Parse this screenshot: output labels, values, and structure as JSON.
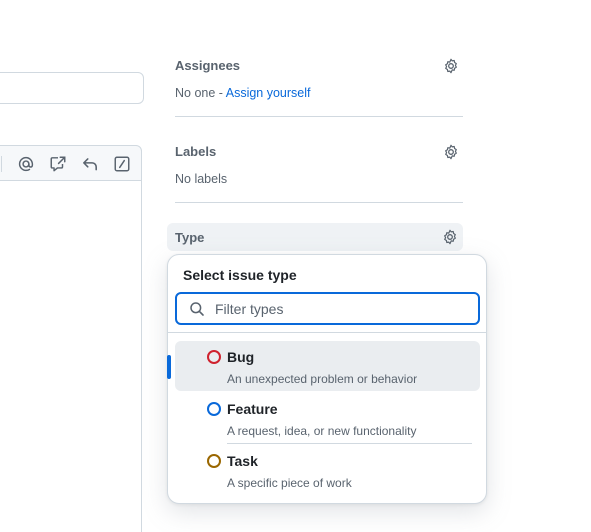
{
  "sidebar": {
    "assignees": {
      "title": "Assignees",
      "value_prefix": "No one - ",
      "assign_link": "Assign yourself"
    },
    "labels": {
      "title": "Labels",
      "value": "No labels"
    },
    "type": {
      "title": "Type"
    }
  },
  "type_dropdown": {
    "title": "Select issue type",
    "filter_placeholder": "Filter types",
    "options": [
      {
        "name": "Bug",
        "description": "An unexpected problem or behavior",
        "color": "#cf222e",
        "selected": true
      },
      {
        "name": "Feature",
        "description": "A request, idea, or new functionality",
        "color": "#0969da",
        "selected": false
      },
      {
        "name": "Task",
        "description": "A specific piece of work",
        "color": "#9a6700",
        "selected": false
      }
    ]
  },
  "editor_toolbar": {
    "icons": [
      "mention-icon",
      "cross-reference-icon",
      "reply-icon",
      "slash-commands-icon"
    ]
  },
  "colors": {
    "accent": "#0969da",
    "border": "#d1d9e0",
    "muted_text": "#59636e"
  }
}
